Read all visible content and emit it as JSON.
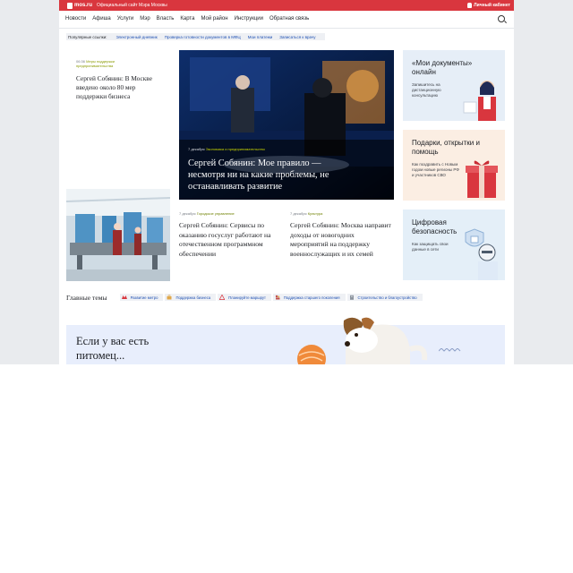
{
  "topbar": {
    "logo": "mos.ru",
    "caption": "Официальный сайт Мэра Москвы",
    "cabinet": "Личный кабинет"
  },
  "nav": {
    "items": [
      "Новости",
      "Афиша",
      "Услуги",
      "Мэр",
      "Власть",
      "Карта",
      "Мой район",
      "Инструкции",
      "Обратная связь"
    ]
  },
  "popular": {
    "label": "Популярные ссылки:",
    "links": [
      "Электронный дневник",
      "Проверка готовности документов в МФЦ",
      "Мои платежи",
      "Записаться к врачу"
    ]
  },
  "news_top_left": {
    "time": "06:36",
    "category": "Меры поддержки предпринимательства",
    "headline": "Сергей Собянин: В Москве введено около 80 мер поддержки бизнеса"
  },
  "featured": {
    "date": "7 декабря",
    "category": "Экономика и предпринимательство",
    "headline": "Сергей Собянин: Мое правило — несмотря ни на какие проблемы, не останавливать развитие"
  },
  "news_a": {
    "date": "7 декабря",
    "category": "Городское управление",
    "headline": "Сергей Собянин: Сервисы по оказанию госуслуг работают на отечественном программном обеспечении"
  },
  "news_b": {
    "date": "7 декабря",
    "category": "Культура",
    "headline": "Сергей Собянин: Москва направит доходы от новогодних мероприятий на поддержку военнослужащих и их семей"
  },
  "promos": [
    {
      "title": "«Мои документы» онлайн",
      "subtitle": "Запишитесь на дистанционную консультацию"
    },
    {
      "title": "Подарки, открытки и помощь",
      "subtitle": "Как поздравить с Новым годом новые регионы РФ и участников СВО"
    },
    {
      "title": "Цифровая безопасность",
      "subtitle": "Как защищать свои данные в сети"
    }
  ],
  "topics": {
    "title": "Главные темы",
    "items": [
      {
        "label": "Развитие метро",
        "icon": "metro-icon"
      },
      {
        "label": "Поддержка бизнеса",
        "icon": "business-icon"
      },
      {
        "label": "Планируйте маршрут",
        "icon": "route-warning-icon"
      },
      {
        "label": "Поддержка старшего поколения",
        "icon": "seniors-icon"
      },
      {
        "label": "Строительство и благоустройство",
        "icon": "building-icon"
      }
    ]
  },
  "pet_banner": {
    "title": "Если у вас есть питомец..."
  },
  "colors": {
    "brand_red": "#d9363e",
    "link_blue": "#1d4fb2",
    "category_green": "#8a9a00"
  }
}
